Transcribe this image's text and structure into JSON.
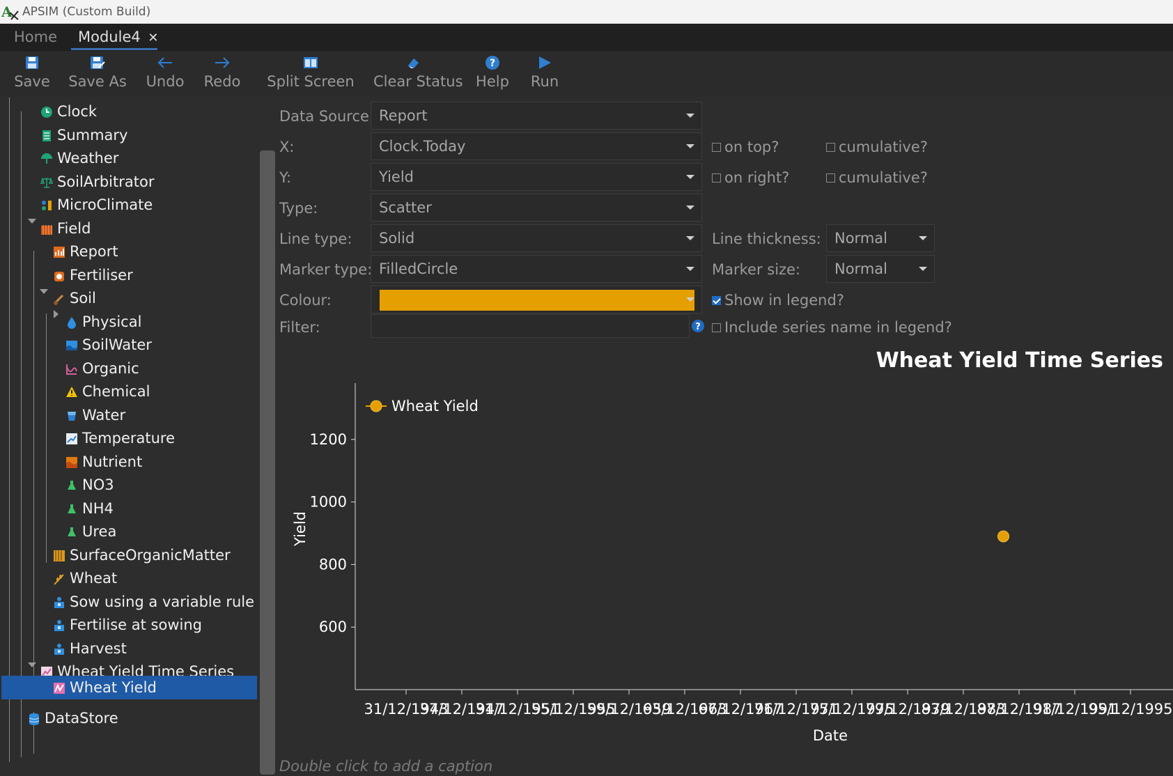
{
  "window": {
    "title": "APSIM (Custom Build)"
  },
  "tabs": [
    {
      "label": "Home",
      "active": false
    },
    {
      "label": "Module4",
      "active": true,
      "close": "✕"
    }
  ],
  "toolbar": [
    {
      "label": "Save",
      "icon": "save-icon"
    },
    {
      "label": "Save As",
      "icon": "save-as-icon"
    },
    {
      "label": "Undo",
      "icon": "undo-icon"
    },
    {
      "label": "Redo",
      "icon": "redo-icon"
    },
    {
      "label": "Split Screen",
      "icon": "split-screen-icon"
    },
    {
      "label": "Clear Status",
      "icon": "eraser-icon"
    },
    {
      "label": "Help",
      "icon": "help-icon"
    },
    {
      "label": "Run",
      "icon": "run-icon"
    }
  ],
  "tree": [
    {
      "label": "Clock",
      "icon": "clock-icon"
    },
    {
      "label": "Summary",
      "icon": "summary-icon"
    },
    {
      "label": "Weather",
      "icon": "weather-icon"
    },
    {
      "label": "SoilArbitrator",
      "icon": "scales-icon"
    },
    {
      "label": "MicroClimate",
      "icon": "microclimate-icon"
    },
    {
      "label": "Field",
      "icon": "field-icon",
      "expanded": true
    },
    {
      "label": "Report",
      "icon": "report-icon"
    },
    {
      "label": "Fertiliser",
      "icon": "fertiliser-icon"
    },
    {
      "label": "Soil",
      "icon": "soil-icon",
      "expanded": true
    },
    {
      "label": "Physical",
      "icon": "physical-icon",
      "expanded": false
    },
    {
      "label": "SoilWater",
      "icon": "soilwater-icon"
    },
    {
      "label": "Organic",
      "icon": "organic-icon"
    },
    {
      "label": "Chemical",
      "icon": "chemical-icon"
    },
    {
      "label": "Water",
      "icon": "water-icon"
    },
    {
      "label": "Temperature",
      "icon": "temperature-icon"
    },
    {
      "label": "Nutrient",
      "icon": "nutrient-icon"
    },
    {
      "label": "NO3",
      "icon": "solute-icon"
    },
    {
      "label": "NH4",
      "icon": "solute-icon"
    },
    {
      "label": "Urea",
      "icon": "solute-icon"
    },
    {
      "label": "SurfaceOrganicMatter",
      "icon": "surface-organic-matter-icon"
    },
    {
      "label": "Wheat",
      "icon": "wheat-icon"
    },
    {
      "label": "Sow using a variable rule",
      "icon": "manager-icon"
    },
    {
      "label": "Fertilise at sowing",
      "icon": "manager-icon"
    },
    {
      "label": "Harvest",
      "icon": "manager-icon"
    },
    {
      "label": "Wheat Yield Time Series",
      "icon": "graph-icon",
      "expanded": true
    },
    {
      "label": "Wheat Yield",
      "icon": "series-icon",
      "selected": true
    },
    {
      "label": "DataStore",
      "icon": "datastore-icon"
    }
  ],
  "props": {
    "data_source": {
      "label": "Data Source:",
      "value": "Report"
    },
    "x": {
      "label": "X:",
      "value": "Clock.Today"
    },
    "y": {
      "label": "Y:",
      "value": "Yield"
    },
    "type": {
      "label": "Type:",
      "value": "Scatter"
    },
    "line_type": {
      "label": "Line type:",
      "value": "Solid"
    },
    "marker_type": {
      "label": "Marker type:",
      "value": "FilledCircle"
    },
    "colour": {
      "label": "Colour:",
      "value": "#E69F00"
    },
    "filter": {
      "label": "Filter:",
      "value": ""
    },
    "line_thickness": {
      "label": "Line thickness:",
      "value": "Normal"
    },
    "marker_size": {
      "label": "Marker size:",
      "value": "Normal"
    },
    "x_on_top": {
      "label": "on top?",
      "checked": false
    },
    "x_cumulative": {
      "label": "cumulative?",
      "checked": false
    },
    "y_on_right": {
      "label": "on right?",
      "checked": false
    },
    "y_cumulative": {
      "label": "cumulative?",
      "checked": false
    },
    "show_in_legend": {
      "label": "Show in legend?",
      "checked": true
    },
    "include_series_name": {
      "label": "Include series name in legend?",
      "checked": false
    }
  },
  "chart_data": {
    "type": "scatter",
    "title": "Wheat Yield Time Series",
    "xlabel": "Date",
    "ylabel": "Yield",
    "x_ticks": [
      "31/12/1943",
      "31/12/1947",
      "31/12/1951",
      "31/12/1955",
      "31/12/1959",
      "31/12/1963",
      "31/12/1967",
      "31/12/1971",
      "31/12/1975",
      "31/12/1979",
      "31/12/1983",
      "31/12/1987",
      "31/12/1991",
      "31/12/1995"
    ],
    "x_tick_labels": [
      "31/12/1943",
      "37/12/1947",
      "31/12/1951",
      "55/12/1955",
      "59/12/1959",
      "63/12/1963",
      "67/12/1967",
      "71/12/1971",
      "75/12/1975",
      "79/12/1979",
      "83/12/1983",
      "87/12/1987",
      "91/12/1991",
      "95/12/1995"
    ],
    "y_ticks": [
      600,
      800,
      1000,
      1200
    ],
    "ylim": [
      400,
      1380
    ],
    "legend": "top-left",
    "series": [
      {
        "name": "Wheat Yield",
        "color": "#E69F00",
        "points": [
          {
            "x": "1986-11-15",
            "y": 890
          }
        ]
      }
    ]
  },
  "caption": "Double click to add a caption"
}
